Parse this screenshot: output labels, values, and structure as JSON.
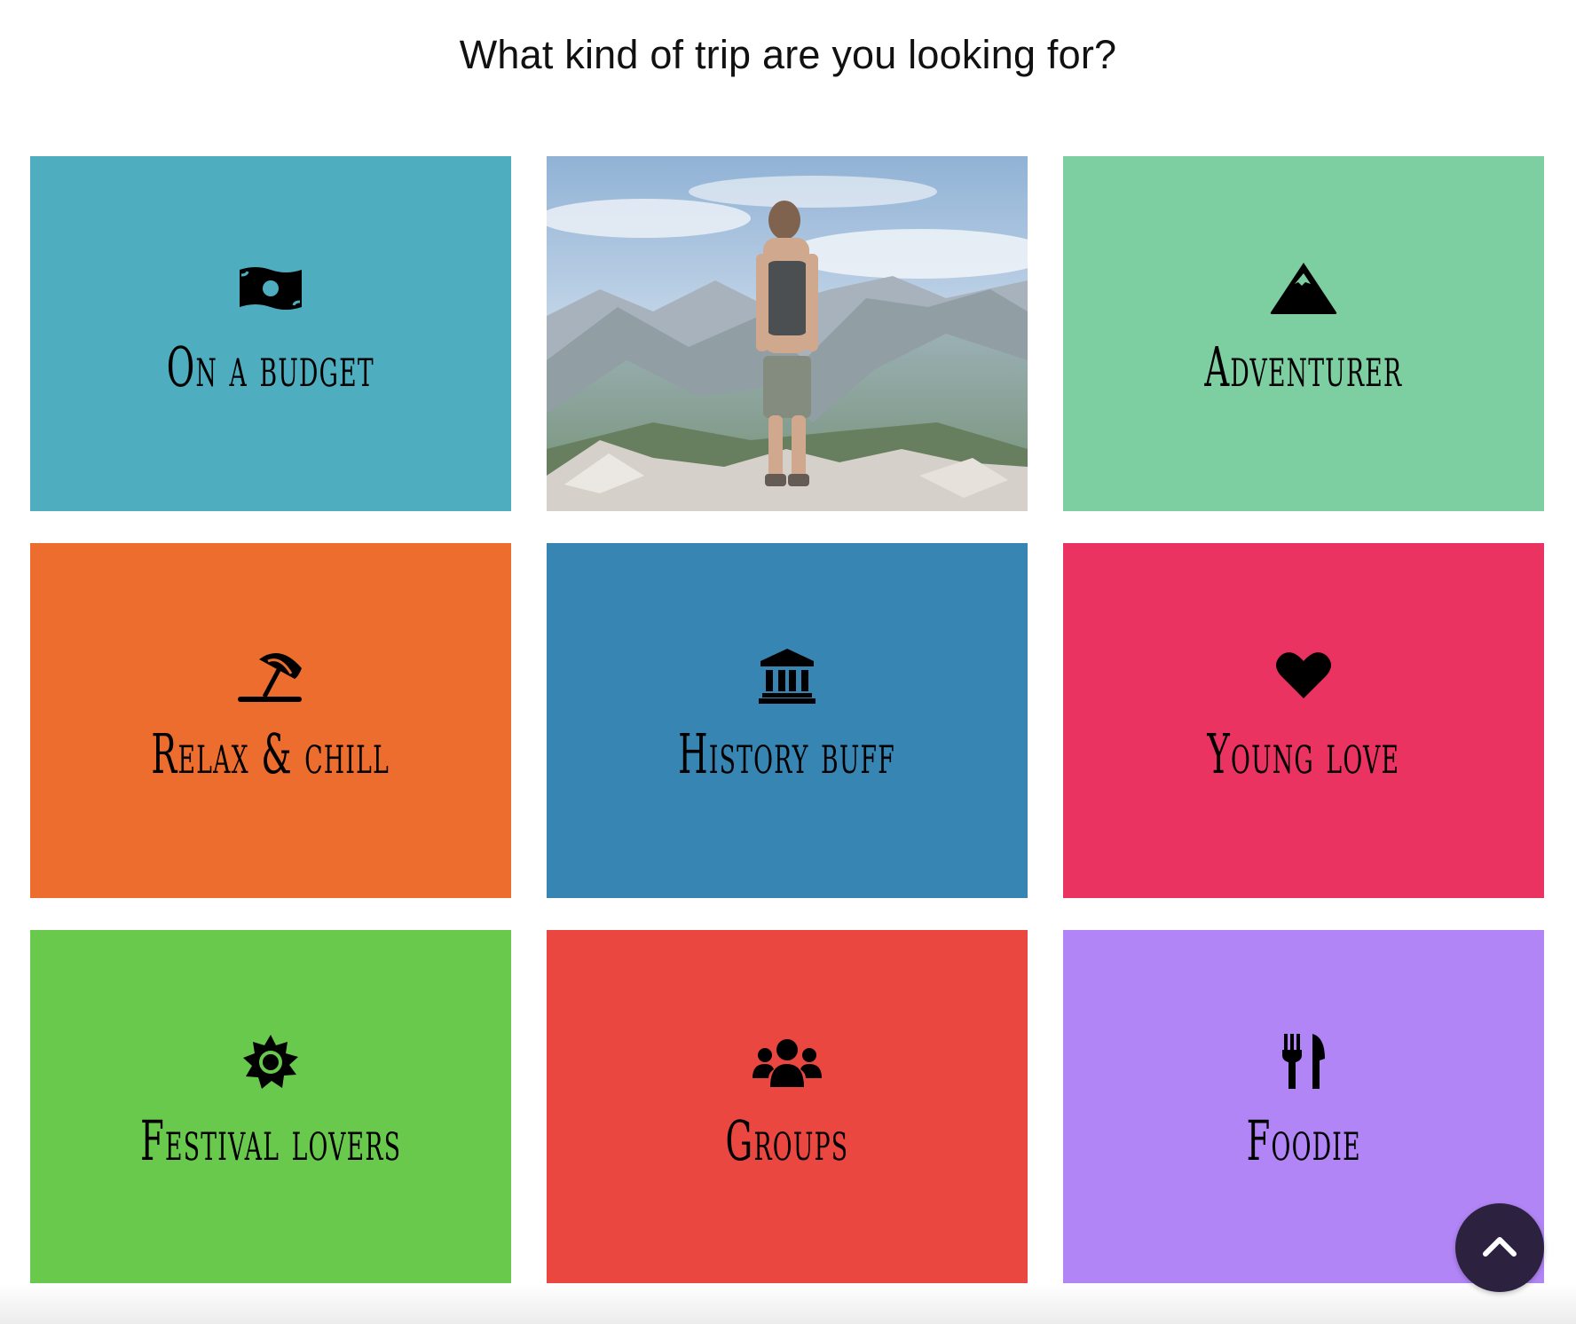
{
  "heading": "What kind of trip are you looking for?",
  "tiles": [
    {
      "label": "On a budget",
      "icon": "money-bill-icon",
      "color": "#4eaebf"
    },
    {
      "label": "",
      "icon": "hiker-photo",
      "color": "#9fb7cc"
    },
    {
      "label": "Adventurer",
      "icon": "mountain-icon",
      "color": "#7dcea0"
    },
    {
      "label": "Relax & chill",
      "icon": "umbrella-beach-icon",
      "color": "#ed6d2e"
    },
    {
      "label": "History buff",
      "icon": "landmark-icon",
      "color": "#3785b2"
    },
    {
      "label": "Young love",
      "icon": "heart-icon",
      "color": "#ea3361"
    },
    {
      "label": "Festival lovers",
      "icon": "sun-icon",
      "color": "#69c94d"
    },
    {
      "label": "Groups",
      "icon": "users-icon",
      "color": "#eb4741"
    },
    {
      "label": "Foodie",
      "icon": "utensils-icon",
      "color": "#b285f7"
    }
  ],
  "scroll_top": {
    "icon": "chevron-up-icon",
    "color": "#2c2240"
  }
}
